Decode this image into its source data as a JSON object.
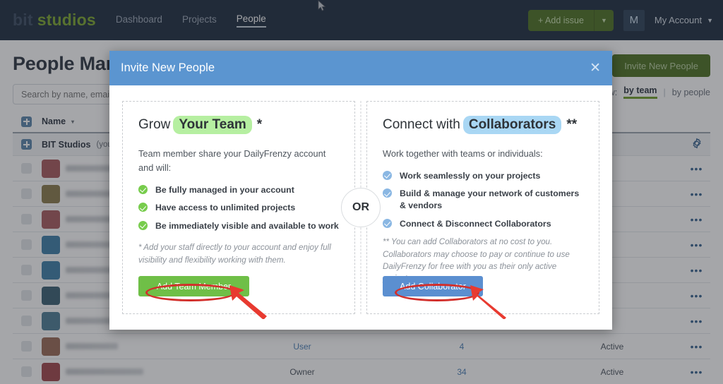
{
  "topnav": {
    "brand_part1": "bit",
    "brand_part2": "studios",
    "links": [
      {
        "label": "Dashboard",
        "active": false
      },
      {
        "label": "Projects",
        "active": false
      },
      {
        "label": "People",
        "active": true
      }
    ],
    "add_issue_label": "+ Add issue",
    "add_issue_caret": "▼",
    "avatar_initial": "M",
    "account_label": "My Account",
    "account_caret": "⌄"
  },
  "page": {
    "title": "People Management",
    "invite_button": "Invite New People",
    "search_placeholder": "Search by name, email or team",
    "search_value": "",
    "view_label": "View:",
    "view_by_team": "by team",
    "view_separator": "|",
    "view_by_people": "by people"
  },
  "table": {
    "headers": {
      "name": "Name",
      "sort_caret": "▾"
    },
    "org_row": {
      "name": "BIT Studios",
      "suffix": "(your team)",
      "gear": "gear-icon"
    },
    "action_glyph": "•••",
    "rows": [
      {
        "name": "",
        "role": "",
        "projects": "",
        "status": "",
        "avatar": "#a8585c",
        "blur": true
      },
      {
        "name": "",
        "role": "",
        "projects": "",
        "status": "",
        "avatar": "#8a7a4a",
        "blur": true
      },
      {
        "name": "",
        "role": "",
        "projects": "",
        "status": "",
        "avatar": "#a75a5e",
        "blur": true
      },
      {
        "name": "",
        "role": "",
        "projects": "",
        "status": "",
        "avatar": "#3d7fa8",
        "blur": true
      },
      {
        "name": "",
        "role": "",
        "projects": "",
        "status": "",
        "avatar": "#3d7fa8",
        "blur": true
      },
      {
        "name": "",
        "role": "",
        "projects": "",
        "status": "",
        "avatar": "#3a5f72",
        "blur": true
      },
      {
        "name": "",
        "role": "",
        "projects": "",
        "status": "",
        "avatar": "#4c7d94",
        "blur": true
      },
      {
        "name": "",
        "role": "User",
        "projects": "4",
        "status": "Active",
        "avatar": "#9a6a55",
        "blur": true
      },
      {
        "name": "",
        "role": "Owner",
        "projects": "34",
        "status": "Active",
        "avatar": "#a1454a",
        "blur": true
      }
    ]
  },
  "modal": {
    "title": "Invite New People",
    "close_glyph": "✕",
    "or_label": "OR",
    "left": {
      "heading_prefix": "Grow",
      "heading_highlight": "Your Team",
      "heading_suffix": "*",
      "lead": "Team member share your DailyFrenzy account and will:",
      "features": [
        "Be fully managed in your account",
        "Have access to unlimited projects",
        "Be immediately visible and available to work"
      ],
      "note": "* Add your staff directly to your account and enjoy full visibility and flexibility working with them.",
      "cta": "Add Team Member"
    },
    "right": {
      "heading_prefix": "Connect with",
      "heading_highlight": "Collaborators",
      "heading_suffix": "**",
      "lead": "Work together with teams or individuals:",
      "features": [
        "Work seamlessly on your projects",
        "Build & manage your network of customers & vendors",
        "Connect & Disconnect Collaborators"
      ],
      "note": "** You can add Collaborators at no cost to you. Collaborators may choose to pay or continue to use DailyFrenzy for free with you as their only active project.",
      "cta": "Add Collaborator"
    }
  },
  "colors": {
    "nav_bg": "#1d2b3f",
    "brand_green": "#7aa62d",
    "modal_header_blue": "#5b95d0",
    "cta_green": "#6fbf47",
    "cta_blue": "#5b8fd0",
    "highlight_green": "#b6efa1",
    "highlight_blue": "#a9d7f4",
    "annotation_red": "#d22f2b"
  }
}
